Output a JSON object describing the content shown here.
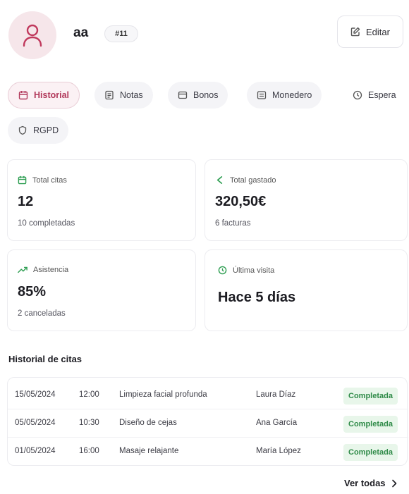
{
  "header": {
    "username": "aa",
    "id_badge": "#11",
    "edit_label": "Editar"
  },
  "tabs": [
    {
      "label": "Historial",
      "icon": "calendar-icon",
      "active": true
    },
    {
      "label": "Notas",
      "icon": "notes-icon",
      "active": false
    },
    {
      "label": "Bonos",
      "icon": "voucher-icon",
      "active": false
    },
    {
      "label": "Monedero",
      "icon": "wallet-icon",
      "active": false
    },
    {
      "label": "Espera",
      "icon": "clock-icon",
      "active": false
    },
    {
      "label": "RGPD",
      "icon": "shield-icon",
      "active": false
    }
  ],
  "stats": {
    "total_citas": {
      "label": "Total citas",
      "value": "12",
      "sub": "10 completadas"
    },
    "total_gastado": {
      "label": "Total gastado",
      "value": "320,50€",
      "sub": "6 facturas"
    },
    "asistencia": {
      "label": "Asistencia",
      "value": "85%",
      "sub": "2 canceladas"
    },
    "ultima_visita": {
      "label": "Última visita",
      "value": "Hace 5 días"
    }
  },
  "history": {
    "title": "Historial de citas",
    "rows": [
      {
        "date": "15/05/2024",
        "time": "12:00",
        "service": "Limpieza facial profunda",
        "staff": "Laura Díaz",
        "status": "Completada"
      },
      {
        "date": "05/05/2024",
        "time": "10:30",
        "service": "Diseño de cejas",
        "staff": "Ana García",
        "status": "Completada"
      },
      {
        "date": "01/05/2024",
        "time": "16:00",
        "service": "Masaje relajante",
        "staff": "María López",
        "status": "Completada"
      }
    ],
    "see_all": "Ver todas"
  },
  "colors": {
    "accent": "#b23a5c",
    "success": "#2e8a47",
    "success_bg": "#e8f6ea"
  }
}
